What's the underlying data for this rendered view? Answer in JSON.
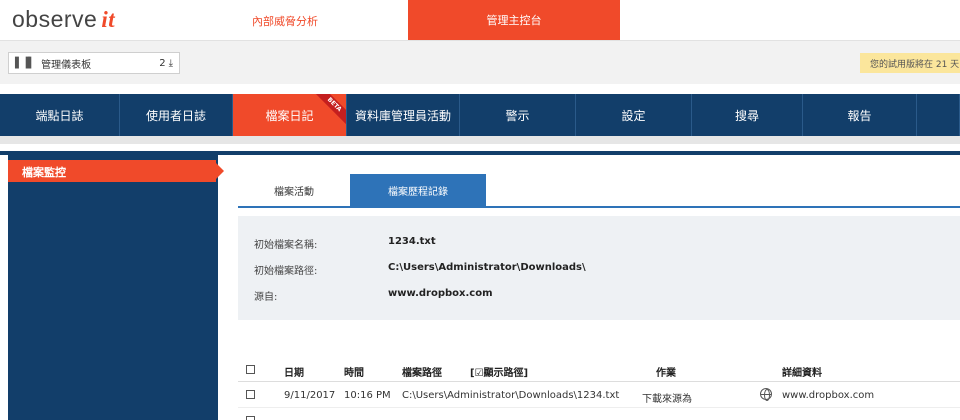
{
  "header": {
    "logo_text": "observe",
    "logo_it": "it",
    "tab_insider": "內部威脅分析",
    "tab_console": "管理主控台"
  },
  "subbar": {
    "dashboard_label": "管理儀表板",
    "dashboard_count": "2",
    "trial_notice": "您的試用版將在 21 天"
  },
  "mainnav": {
    "items": [
      {
        "label": "端點日誌"
      },
      {
        "label": "使用者日誌"
      },
      {
        "label": "檔案日記",
        "badge": "BETA"
      },
      {
        "label": "資料庫管理員活動"
      },
      {
        "label": "警示"
      },
      {
        "label": "設定"
      },
      {
        "label": "搜尋"
      },
      {
        "label": "報告"
      }
    ]
  },
  "sidebar": {
    "active_item": "檔案監控"
  },
  "tabs": {
    "activity": "檔案活動",
    "history": "檔案歷程記錄"
  },
  "info": {
    "name_label": "初始檔案名稱:",
    "name_value": "1234.txt",
    "path_label": "初始檔案路徑:",
    "path_value": "C:\\Users\\Administrator\\Downloads\\",
    "source_label": "源自:",
    "source_value": "www.dropbox.com"
  },
  "table": {
    "headers": {
      "date": "日期",
      "time": "時間",
      "path": "檔案路徑",
      "show_path": "[☑顯示路徑]",
      "action": "作業",
      "details": "詳細資料"
    },
    "rows": [
      {
        "date": "9/11/2017",
        "time": "10:16 PM",
        "path": "C:\\Users\\Administrator\\Downloads\\1234.txt",
        "action": "下載來源為",
        "details": "www.dropbox.com"
      }
    ]
  },
  "colors": {
    "accent": "#f04a2a",
    "nav": "#123e6a",
    "tab_active": "#2e73b8"
  }
}
